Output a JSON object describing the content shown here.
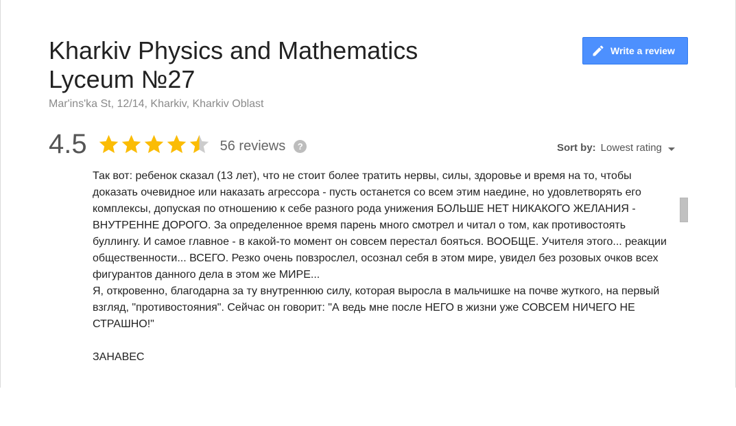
{
  "place": {
    "title": "Kharkiv Physics and Mathematics Lyceum №27",
    "address": "Mar'ins'ka St, 12/14, Kharkiv, Kharkiv Oblast"
  },
  "actions": {
    "write_review_label": "Write a review",
    "write_review_icon": "pencil-icon"
  },
  "rating": {
    "value": "4.5",
    "stars_filled_fraction": 0.9,
    "review_count": "56 reviews",
    "help_icon": "question-circle-icon",
    "star_color": "#fbbc05",
    "star_empty_color": "#cccccc"
  },
  "sort": {
    "label": "Sort by:",
    "value": "Lowest rating"
  },
  "review": {
    "text": "Так вот: ребенок сказал (13 лет), что не стоит более тратить нервы, силы, здоровье и время на то, чтобы доказать очевидное или наказать агрессора - пусть останется со всем этим наедине, но удовлетворять его комплексы, допуская по отношению к себе разного рода унижения БОЛЬШЕ НЕТ НИКАКОГО ЖЕЛАНИЯ - ВНУТРЕННЕ ДОРОГО. За определенное время парень много смотрел и читал о том, как противостоять буллингу. И самое главное - в какой-то момент он совсем перестал бояться. ВООБЩЕ. Учителя этого... реакции общественности... ВСЕГО. Резко очень повзрослел, осознал себя в этом мире, увидел без розовых очков всех фигурантов данного дела в этом же МИРЕ...\n Я, откровенно, благодарна за ту внутреннюю силу, которая выросла в мальчишке на почве жуткого, на первый взгляд, \"противостояния\". Сейчас он говорит: \"А ведь мне после НЕГО в жизни уже СОВСЕМ НИЧЕГО НЕ СТРАШНО!\"\n\nЗАНАВЕС"
  },
  "colors": {
    "button_blue": "#4d90fe",
    "scrollbar": "#c1c1c1"
  }
}
